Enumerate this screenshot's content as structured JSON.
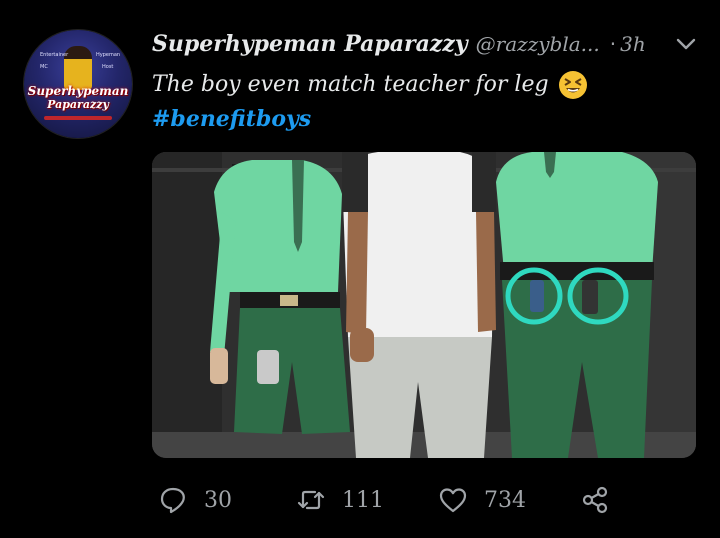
{
  "tweet": {
    "author": {
      "display_name": "Superhypeman Paparazzy",
      "handle": "@razzybla...",
      "avatar_line1": "Superhypeman",
      "avatar_line2": "Paparazzy",
      "avatar_small": {
        "top_left": "Entertainer",
        "top_right": "Hypeman",
        "mid_left": "MC",
        "mid_right": "Host"
      }
    },
    "separator": "·",
    "time": "3h",
    "text_line1": "The boy even match teacher for leg",
    "emoji": "grinning-squinting-face",
    "hashtag": "#benefitboys",
    "image_alt": "Three people posing against a dark wall; two students in green uniforms and one in a white shirt with jeans, with circled items at waist",
    "actions": {
      "replies": "30",
      "retweets": "111",
      "likes": "734"
    }
  },
  "colors": {
    "background": "#000000",
    "text": "#e7e9ea",
    "muted": "#a0a4a8",
    "link": "#1d9bf0",
    "annotation": "#2fd9c0"
  }
}
